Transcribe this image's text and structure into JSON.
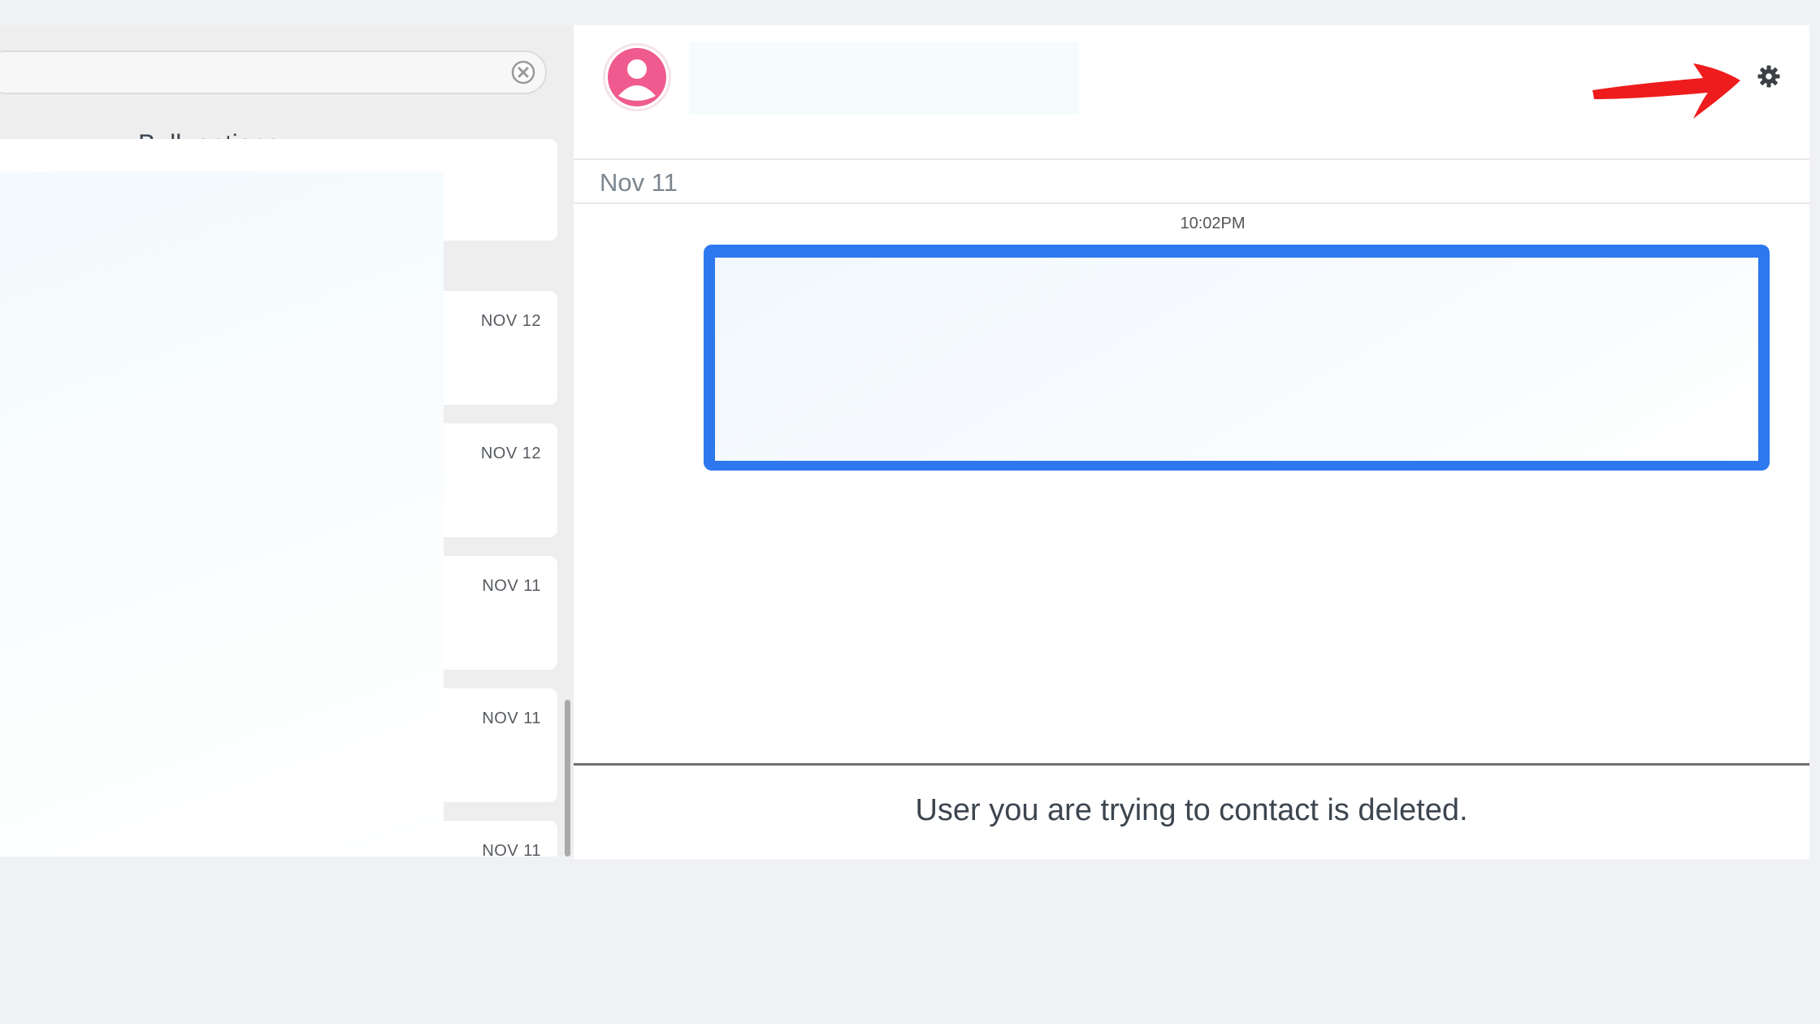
{
  "search": {
    "value": "",
    "placeholder": ""
  },
  "list": {
    "bulk_options_label": "Bulk options",
    "conversations": [
      {
        "date": ""
      },
      {
        "date": "NOV 12"
      },
      {
        "date": "NOV 12"
      },
      {
        "date": "NOV 11"
      },
      {
        "date": "NOV 11"
      },
      {
        "date": "NOV 11"
      }
    ]
  },
  "chat": {
    "date_separator": "Nov 11",
    "message_time": "10:02PM",
    "deleted_notice": "User you are trying to contact is deleted."
  },
  "icons": {
    "clear": "clear-icon",
    "chevron": "chevron-down-icon",
    "avatar": "user-avatar-icon",
    "settings": "gear-icon",
    "annotation": "red-arrow-annotation"
  },
  "colors": {
    "highlight_border": "#2d78ee",
    "avatar_pink": "#f05b8f",
    "annotation_red": "#ee1c1c",
    "page_background": "#f0f1f4"
  }
}
